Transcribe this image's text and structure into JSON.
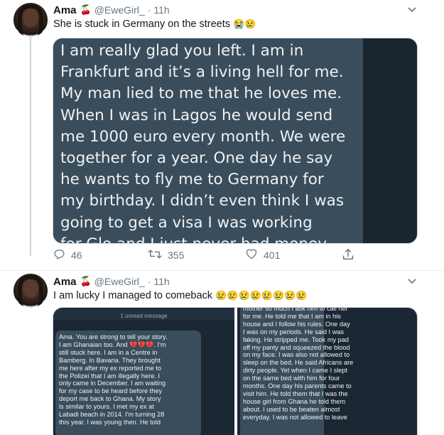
{
  "tweets": [
    {
      "author_name": "Ama",
      "author_emoji": "🍒",
      "handle": "@EweGirl_",
      "separator": "·",
      "time": "11h",
      "text": "She is stuck in Germany on the streets",
      "text_emoji": "😭😢",
      "media_text": "I am really glad you left. I am in\nFrankfurt and it’s a living hell for me.\nMy man lied to me that he loves me.\nWhen I was in Lagos he would send\nme 1000 euro every month. We were\ntogether for a year. One day he say\nhe wants to fly me to Germany for\nmy birthday. I didn’t even think I was\ngoing to get a visa I was working\nfor Glo and I just never had money",
      "replies": "46",
      "retweets": "355",
      "likes": "401"
    },
    {
      "author_name": "Ama",
      "author_emoji": "🍒",
      "handle": "@EweGirl_",
      "separator": "·",
      "time": "11h",
      "text": "I am lucky I managed to comeback",
      "text_emoji": "😢😢😢😢😢😢😢😢",
      "unread_label": "1 unread message",
      "media_left_text": "Ama. You are strong to tell your story.\nI am Ghanaian too. And 💔💔💔. I'm\nstill stuck here. I am in a Centre in\nBamberg. In Bavaria. They brought\nme here after my ex reported me to\nthe Polizei that I am illegally here. I\nonly came in December. I am waiting\nfor my case to be heard before they\ndeport me back to Ghana. My story\nis similar to yours. I met my ex at\nLabadi beach in 2014. I'm turning 28\nthis year. I was young then. He told",
      "media_right_text": "mother so much I ask him to call her\nfor me. He told me that I am in his\nhouse and I follow his rules. One day\nI was on my periods. He said I was\nfaking. He stripped me. Took my pad\noff my panty and squeezed the blood\non my face. I was also not allowed to\nsleep on the bed. He said Africans are\ndirty people. Yet when I came I slept\non the same bed with him for four\nmonths. One day his parents came to\nvisit him. He told them that I was the\nhouse girl from Ghana he told them\nabout. I used to be beaten almost\neveryday. I was not allowed to leave"
    }
  ],
  "icons": {
    "reply": "reply-icon",
    "retweet": "retweet-icon",
    "like": "heart-icon",
    "share": "share-icon",
    "more": "chevron-down-icon"
  },
  "colors": {
    "secondary_text": "#657786",
    "chat_bubble": "#3a4d5c",
    "chat_background": "#1b2733"
  }
}
